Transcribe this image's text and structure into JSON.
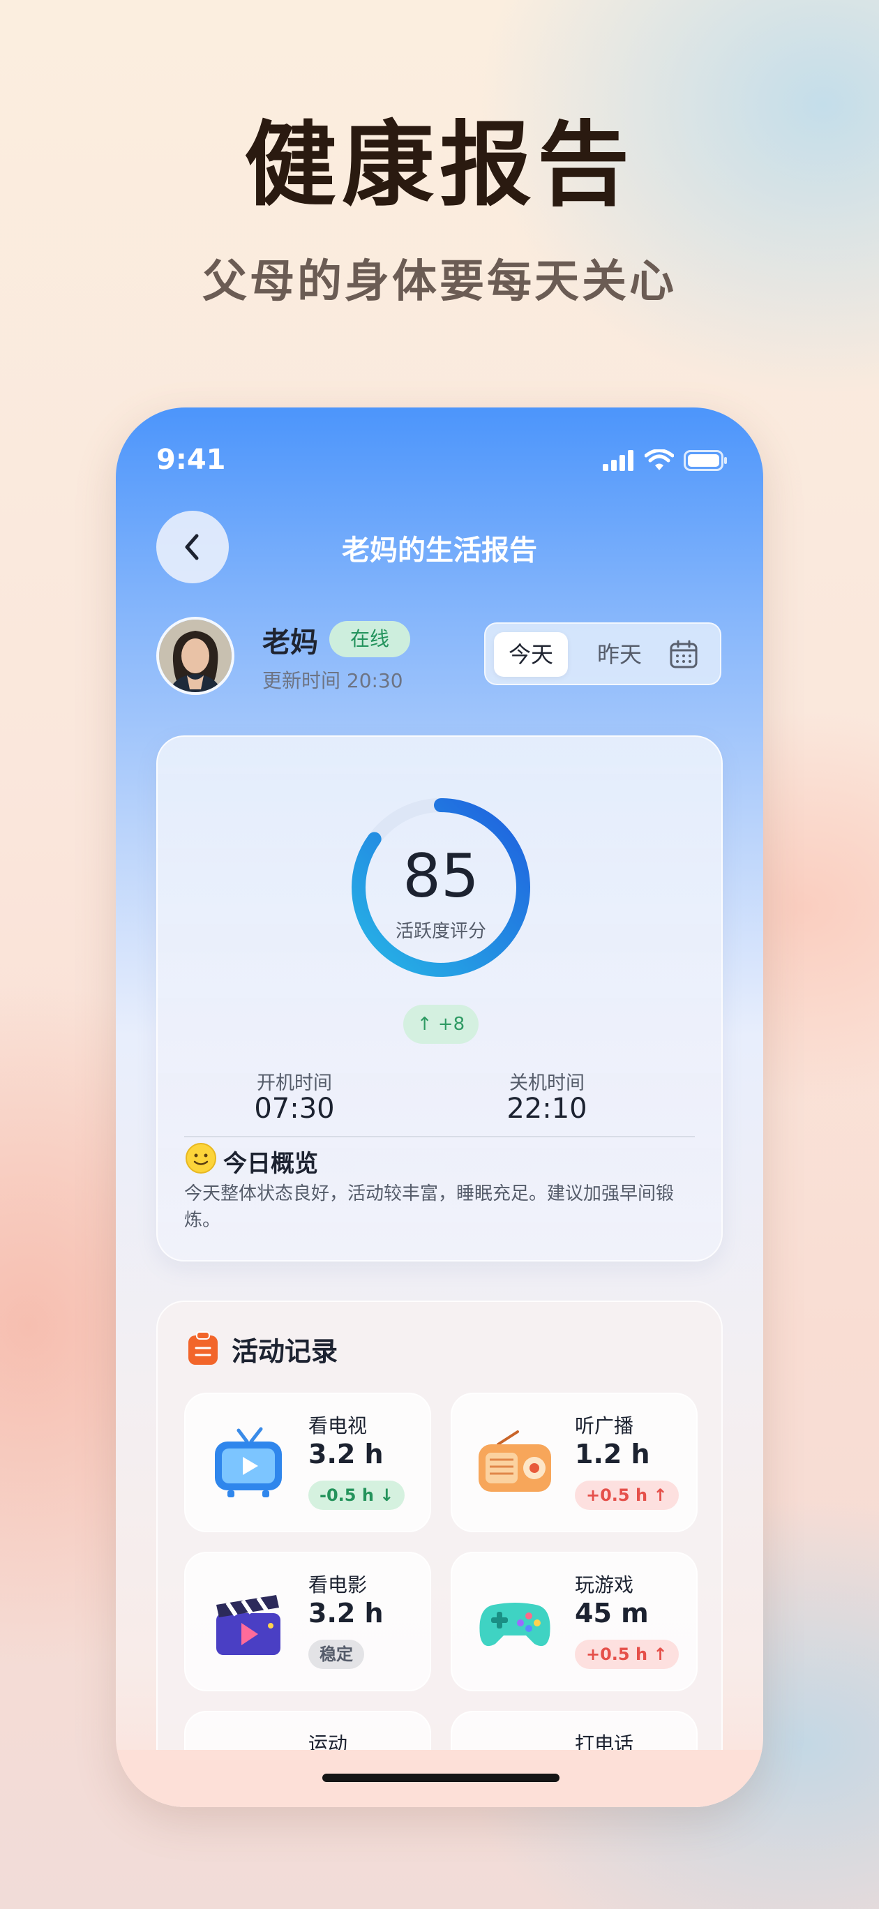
{
  "promo": {
    "headline": "健康报告",
    "subheadline": "父母的身体要每天关心"
  },
  "status_bar": {
    "time": "9:41",
    "icons": [
      "cellular-signal-icon",
      "wifi-icon",
      "battery-icon"
    ]
  },
  "nav": {
    "back_icon": "chevron-left-icon",
    "title": "老妈的生活报告"
  },
  "profile": {
    "name": "老妈",
    "status": "在线",
    "update_time": "更新时间 20:30"
  },
  "date_tabs": {
    "options": [
      "今天",
      "昨天"
    ],
    "selected": "今天",
    "calendar_icon": "calendar-icon"
  },
  "score": {
    "value": "85",
    "label": "活跃度评分",
    "progress": 0.85,
    "delta": "+8",
    "stats": [
      {
        "label": "开机时间",
        "value": "07:30"
      },
      {
        "label": "关机时间",
        "value": "22:10"
      }
    ]
  },
  "overview": {
    "icon": "smiley-face-icon",
    "title": "今日概览",
    "text": "今天整体状态良好，活动较丰富，睡眠充足。建议加强早间锻炼。"
  },
  "activity": {
    "icon": "clipboard-icon",
    "title": "活动记录",
    "items": [
      {
        "name": "看电视",
        "value": "3.2 h",
        "badge": "-0.5 h",
        "trend": "down",
        "icon": "tv-icon"
      },
      {
        "name": "听广播",
        "value": "1.2 h",
        "badge": "+0.5 h",
        "trend": "up",
        "icon": "radio-icon"
      },
      {
        "name": "看电影",
        "value": "3.2 h",
        "badge": "稳定",
        "trend": "flat",
        "icon": "movie-clapper-icon"
      },
      {
        "name": "玩游戏",
        "value": "45 m",
        "badge": "+0.5 h",
        "trend": "up",
        "icon": "gamepad-icon"
      },
      {
        "name": "运动",
        "icon": "sport-icon"
      },
      {
        "name": "打电话",
        "icon": "phone-call-icon"
      }
    ]
  },
  "colors": {
    "accent_blue": "#4c95fb",
    "ring_blue": "#1f6fe0",
    "positive_green": "#24935b",
    "negative_red": "#e5504a"
  }
}
